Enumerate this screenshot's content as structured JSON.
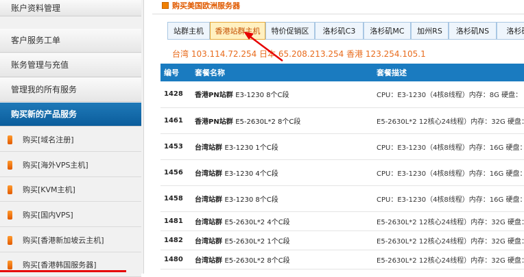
{
  "sidebar": {
    "main_items": [
      {
        "label": "账户资料管理"
      },
      {
        "label": "客户服务工单"
      },
      {
        "label": "账务管理与充值"
      },
      {
        "label": "管理我的所有服务"
      },
      {
        "label": "购买新的产品服务"
      }
    ],
    "sub_items": [
      {
        "label": "购买[域名注册]"
      },
      {
        "label": "购买[海外VPS主机]"
      },
      {
        "label": "购买[KVM主机]"
      },
      {
        "label": "购买[国内VPS]"
      },
      {
        "label": "购买[香港新加坡云主机]"
      },
      {
        "label": "购买[香港韩国服务器]"
      }
    ]
  },
  "header": {
    "title": "购买美国欧洲服务器"
  },
  "tabs": [
    {
      "label": "站群主机"
    },
    {
      "label": "香港站群主机"
    },
    {
      "label": "特价促销区"
    },
    {
      "label": "洛杉矶C3"
    },
    {
      "label": "洛杉矶MC"
    },
    {
      "label": "加州RS"
    },
    {
      "label": "洛杉矶NS"
    },
    {
      "label": "洛杉矶"
    }
  ],
  "ip_line": "台湾 103.114.72.254 日本 65.208.213.254 香港 123.254.105.1",
  "table": {
    "headers": {
      "num": "编号",
      "name": "套餐名称",
      "desc": "套餐描述"
    },
    "rows": [
      {
        "num": "1428",
        "name": "香港PN站群",
        "spec": "E3-1230 8个C段",
        "desc": "CPU：E3-1230（4核8线程）内存：8G 硬盘："
      },
      {
        "num": "1461",
        "name": "香港PN站群",
        "spec": "E5-2630L*2 8个C段",
        "desc": "E5-2630L*2 12核心24线程）内存：32G 硬盘："
      },
      {
        "num": "1453",
        "name": "台湾站群",
        "spec": "E3-1230 1个C段",
        "desc": "CPU：E3-1230（4核8线程）内存：16G 硬盘："
      },
      {
        "num": "1456",
        "name": "台湾站群",
        "spec": "E3-1230 4个C段",
        "desc": "CPU：E3-1230（4核8线程）内存：16G 硬盘："
      },
      {
        "num": "1458",
        "name": "台湾站群",
        "spec": "E3-1230 8个C段",
        "desc": "CPU：E3-1230（4核8线程）内存：16G 硬盘："
      },
      {
        "num": "1481",
        "name": "台湾站群",
        "spec": "E5-2630L*2 4个C段",
        "desc": "E5-2630L*2 12核心24线程）内存：32G 硬盘："
      },
      {
        "num": "1482",
        "name": "台湾站群",
        "spec": "E5-2630L*2 1个C段",
        "desc": "E5-2630L*2 12核心24线程）内存：32G 硬盘："
      },
      {
        "num": "1480",
        "name": "台湾站群",
        "spec": "E5-2630L*2 8个C段",
        "desc": "E5-2630L*2 12核心24线程）内存：32G 硬盘："
      }
    ]
  },
  "colors": {
    "accent": "#1a7bc0",
    "orange": "#e86b1c",
    "active_tab_bg": "#fff0c0",
    "annotation_red": "#e60000"
  }
}
